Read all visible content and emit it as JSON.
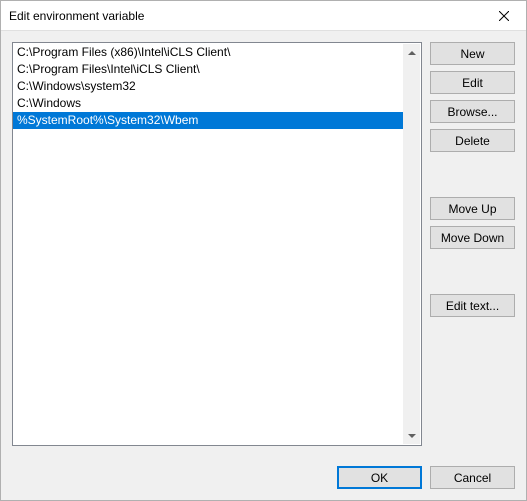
{
  "window": {
    "title": "Edit environment variable"
  },
  "list": {
    "items": [
      "C:\\Program Files (x86)\\Intel\\iCLS Client\\",
      "C:\\Program Files\\Intel\\iCLS Client\\",
      "C:\\Windows\\system32",
      "C:\\Windows",
      "%SystemRoot%\\System32\\Wbem"
    ],
    "selected_index": 4
  },
  "buttons": {
    "new": "New",
    "edit": "Edit",
    "browse": "Browse...",
    "delete": "Delete",
    "move_up": "Move Up",
    "move_down": "Move Down",
    "edit_text": "Edit text...",
    "ok": "OK",
    "cancel": "Cancel"
  }
}
